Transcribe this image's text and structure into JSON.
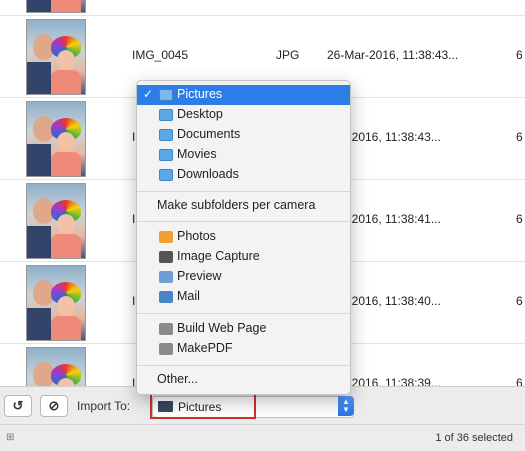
{
  "rows": [
    {
      "name": "",
      "type": "",
      "date": "",
      "size": ""
    },
    {
      "name": "IMG_0045",
      "type": "JPG",
      "date": "26-Mar-2016, 11:38:43...",
      "size": "6"
    },
    {
      "name": "I",
      "type": "",
      "date": "Mar-2016, 11:38:43...",
      "size": "6"
    },
    {
      "name": "I",
      "type": "",
      "date": "Mar-2016, 11:38:41...",
      "size": "6"
    },
    {
      "name": "I",
      "type": "",
      "date": "Mar-2016, 11:38:40...",
      "size": "6"
    },
    {
      "name": "I",
      "type": "",
      "date": "Mar-2016, 11:38:39...",
      "size": "6"
    }
  ],
  "menu": {
    "folders": [
      {
        "label": "Pictures",
        "icon": "pictures-folder-icon",
        "selected": true
      },
      {
        "label": "Desktop",
        "icon": "desktop-folder-icon"
      },
      {
        "label": "Documents",
        "icon": "documents-folder-icon"
      },
      {
        "label": "Movies",
        "icon": "movies-folder-icon"
      },
      {
        "label": "Downloads",
        "icon": "downloads-folder-icon"
      }
    ],
    "check": "✓",
    "subfolders": "Make subfolders per camera",
    "apps": [
      {
        "label": "Photos",
        "icon": "photos-icon",
        "color": "#f0a030"
      },
      {
        "label": "Image Capture",
        "icon": "image-capture-icon",
        "color": "#555555"
      },
      {
        "label": "Preview",
        "icon": "preview-icon",
        "color": "#6f9fd0"
      },
      {
        "label": "Mail",
        "icon": "mail-icon",
        "color": "#4a84c8"
      }
    ],
    "workflows": [
      {
        "label": "Build Web Page",
        "icon": "automator-icon"
      },
      {
        "label": "MakePDF",
        "icon": "automator-icon"
      }
    ],
    "other": "Other..."
  },
  "bottom": {
    "rotate_icon": "rotate-left-icon",
    "delete_icon": "delete-icon",
    "import_label": "Import To:",
    "destination": "Pictures"
  },
  "status": {
    "count": "1 of 36 selected"
  },
  "colors": {
    "accent": "#2e7de6",
    "highlight": "#d0312d"
  }
}
